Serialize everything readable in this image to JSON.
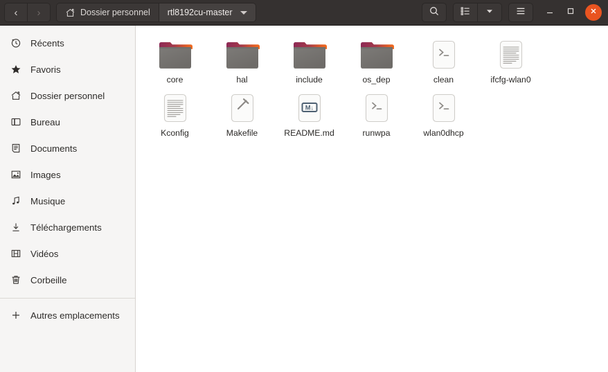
{
  "window": {
    "title": "rtl8192cu-master",
    "accent_color": "#e95420",
    "headerbar_color": "#353130",
    "sidebar_color": "#f6f5f4"
  },
  "header": {
    "back_label": "‹",
    "forward_label": "›",
    "back_icon": "chevron-left-icon",
    "forward_icon": "chevron-right-icon",
    "path": [
      {
        "label": "Dossier personnel",
        "icon": "home-icon",
        "current": false
      },
      {
        "label": "rtl8192cu-master",
        "icon": "",
        "current": true
      }
    ],
    "search_icon": "search-icon",
    "view_list_icon": "view-list-icon",
    "view_dropdown_icon": "chevron-down-icon",
    "menu_icon": "hamburger-menu-icon",
    "minimize_icon": "minimize-icon",
    "maximize_icon": "maximize-icon",
    "close_icon": "close-icon"
  },
  "sidebar": {
    "items": [
      {
        "label": "Récents",
        "icon": "clock-icon"
      },
      {
        "label": "Favoris",
        "icon": "star-icon"
      },
      {
        "label": "Dossier personnel",
        "icon": "home-icon"
      },
      {
        "label": "Bureau",
        "icon": "desktop-icon"
      },
      {
        "label": "Documents",
        "icon": "document-icon"
      },
      {
        "label": "Images",
        "icon": "picture-icon"
      },
      {
        "label": "Musique",
        "icon": "music-note-icon"
      },
      {
        "label": "Téléchargements",
        "icon": "download-icon"
      },
      {
        "label": "Vidéos",
        "icon": "film-icon"
      },
      {
        "label": "Corbeille",
        "icon": "trash-icon"
      }
    ],
    "other_locations": {
      "label": "Autres emplacements",
      "icon": "plus-icon"
    }
  },
  "main": {
    "files": [
      {
        "name": "core",
        "type": "folder"
      },
      {
        "name": "hal",
        "type": "folder"
      },
      {
        "name": "include",
        "type": "folder"
      },
      {
        "name": "os_dep",
        "type": "folder"
      },
      {
        "name": "clean",
        "type": "script"
      },
      {
        "name": "ifcfg-wlan0",
        "type": "text"
      },
      {
        "name": "Kconfig",
        "type": "text"
      },
      {
        "name": "Makefile",
        "type": "makefile"
      },
      {
        "name": "README.md",
        "type": "markdown"
      },
      {
        "name": "runwpa",
        "type": "script"
      },
      {
        "name": "wlan0dhcp",
        "type": "script"
      }
    ]
  }
}
